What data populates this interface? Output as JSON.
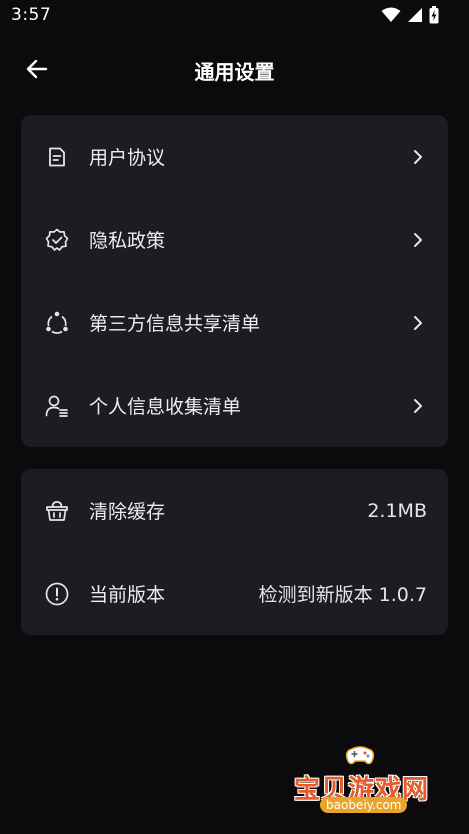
{
  "status_bar": {
    "time": "3:57",
    "icons": [
      "wifi-icon",
      "signal-icon",
      "battery-charging-icon"
    ]
  },
  "header": {
    "title": "通用设置",
    "back_icon": "arrow-left-icon"
  },
  "legal_list": {
    "items": [
      {
        "label": "用户协议",
        "icon": "document-icon"
      },
      {
        "label": "隐私政策",
        "icon": "shield-check-icon"
      },
      {
        "label": "第三方信息共享清单",
        "icon": "share-nodes-icon"
      },
      {
        "label": "个人信息收集清单",
        "icon": "user-list-icon"
      }
    ]
  },
  "app_list": {
    "items": [
      {
        "label": "清除缓存",
        "value": "2.1MB",
        "icon": "basket-icon"
      },
      {
        "label": "当前版本",
        "value": "检测到新版本 1.0.7",
        "icon": "info-circle-icon"
      }
    ]
  },
  "watermark": {
    "text": "宝贝游戏网",
    "url": "baobeiy.com"
  },
  "colors": {
    "background": "#0b0b0d",
    "card": "#1c1c21",
    "text": "#eeeeee",
    "watermark": "#e85a2a"
  }
}
